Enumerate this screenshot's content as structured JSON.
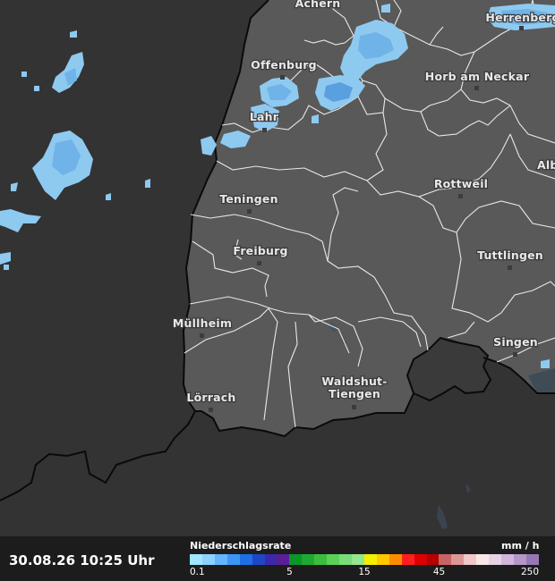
{
  "timestamp": "30.08.26 10:25 Uhr",
  "legend": {
    "title": "Niederschlagsrate",
    "unit": "mm / h",
    "colors": [
      "#a0e6ff",
      "#8cd2ff",
      "#64b4ff",
      "#3c96f5",
      "#1e6ee6",
      "#1e46c8",
      "#3c28aa",
      "#5a1e96",
      "#0a9628",
      "#1eaa32",
      "#3cbe3c",
      "#5ad25a",
      "#78dc78",
      "#96e68c",
      "#f0f000",
      "#ffc800",
      "#ff8c00",
      "#ff1e1e",
      "#dc0000",
      "#b40000",
      "#c86464",
      "#dc9696",
      "#f0c8c8",
      "#fae6e6",
      "#e6d2e6",
      "#d2b4dc",
      "#b496c8",
      "#9678b4"
    ],
    "ticks": [
      {
        "label": "0.1",
        "index": 0
      },
      {
        "label": "5",
        "index": 8
      },
      {
        "label": "15",
        "index": 14
      },
      {
        "label": "45",
        "index": 20
      },
      {
        "label": "250",
        "index": 28
      }
    ]
  },
  "cities": [
    {
      "key": "achern",
      "name": "Achern",
      "dot": false
    },
    {
      "key": "herrenberg",
      "name": "Herrenberg",
      "dot": true
    },
    {
      "key": "offenburg",
      "name": "Offenburg",
      "dot": true
    },
    {
      "key": "horb",
      "name": "Horb am Neckar",
      "dot": true
    },
    {
      "key": "lahr",
      "name": "Lahr",
      "dot": true
    },
    {
      "key": "alb",
      "name": "Alb",
      "dot": false
    },
    {
      "key": "rottweil",
      "name": "Rottweil",
      "dot": true
    },
    {
      "key": "teningen",
      "name": "Teningen",
      "dot": true
    },
    {
      "key": "freiburg",
      "name": "Freiburg",
      "dot": true
    },
    {
      "key": "tuttlingen",
      "name": "Tuttlingen",
      "dot": true
    },
    {
      "key": "muellheim",
      "name": "Müllheim",
      "dot": true
    },
    {
      "key": "singen",
      "name": "Singen",
      "dot": true
    },
    {
      "key": "waldshut1",
      "name": "Waldshut-",
      "dot": false
    },
    {
      "key": "waldshut2",
      "name": "Tiengen",
      "dot": true
    },
    {
      "key": "loerrach",
      "name": "Lörrach",
      "dot": true
    }
  ]
}
